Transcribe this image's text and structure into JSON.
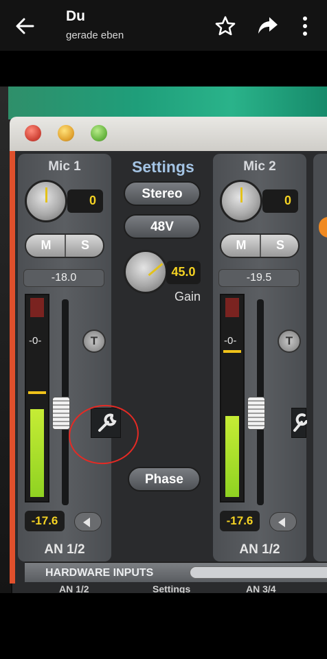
{
  "header": {
    "sender": "Du",
    "time": "gerade eben"
  },
  "mixer": {
    "channel1": {
      "name": "Mic 1",
      "trim": "0",
      "mute": "M",
      "solo": "S",
      "level": "-18.0",
      "meter_zero": "-0-",
      "talkback": "T",
      "output_level": "-17.6",
      "route": "AN 1/2"
    },
    "settings": {
      "title": "Settings",
      "stereo": "Stereo",
      "phantom": "48V",
      "gain_value": "45.0",
      "gain_label": "Gain",
      "phase": "Phase"
    },
    "channel2": {
      "name": "Mic 2",
      "trim": "0",
      "mute": "M",
      "solo": "S",
      "level": "-19.5",
      "meter_zero": "-0-",
      "talkback": "T",
      "output_level": "-17.6",
      "route": "AN 1/2"
    },
    "section_label": "HARDWARE INPUTS",
    "tabs": [
      "AN 1/2",
      "Settings",
      "AN 3/4"
    ]
  },
  "icons": [
    "back-arrow-icon",
    "star-icon",
    "share-icon",
    "more-vert-icon",
    "wrench-icon"
  ]
}
